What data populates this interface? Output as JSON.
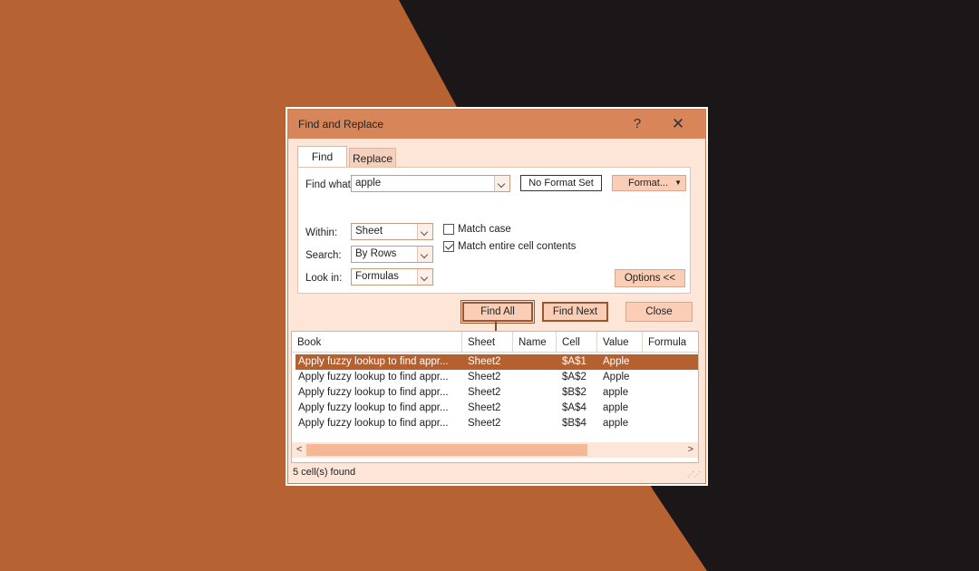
{
  "window": {
    "title": "Find and Replace",
    "help_icon": "?",
    "close_icon": "✕"
  },
  "tabs": [
    {
      "label": "Find",
      "active": true
    },
    {
      "label": "Replace",
      "active": false
    }
  ],
  "find": {
    "find_what_label": "Find what:",
    "find_what_value": "apple",
    "format_status": "No Format Set",
    "format_button": "Format...",
    "within_label": "Within:",
    "within_value": "Sheet",
    "search_label": "Search:",
    "search_value": "By Rows",
    "lookin_label": "Look in:",
    "lookin_value": "Formulas",
    "match_case_label": "Match case",
    "match_case": false,
    "match_entire_label": "Match entire cell contents",
    "match_entire": true,
    "options_button": "Options <<"
  },
  "buttons": {
    "find_all": "Find All",
    "find_next": "Find Next",
    "close": "Close"
  },
  "results": {
    "columns": [
      "Book",
      "Sheet",
      "Name",
      "Cell",
      "Value",
      "Formula"
    ],
    "rows": [
      {
        "book": "Apply fuzzy lookup to find appr...",
        "sheet": "Sheet2",
        "name": "",
        "cell": "$A$1",
        "value": "Apple",
        "formula": ""
      },
      {
        "book": "Apply fuzzy lookup to find appr...",
        "sheet": "Sheet2",
        "name": "",
        "cell": "$A$2",
        "value": "Apple",
        "formula": ""
      },
      {
        "book": "Apply fuzzy lookup to find appr...",
        "sheet": "Sheet2",
        "name": "",
        "cell": "$B$2",
        "value": "apple",
        "formula": ""
      },
      {
        "book": "Apply fuzzy lookup to find appr...",
        "sheet": "Sheet2",
        "name": "",
        "cell": "$A$4",
        "value": "apple",
        "formula": ""
      },
      {
        "book": "Apply fuzzy lookup to find appr...",
        "sheet": "Sheet2",
        "name": "",
        "cell": "$B$4",
        "value": "apple",
        "formula": ""
      }
    ],
    "selected_row": 0
  },
  "status": "5 cell(s) found",
  "colors": {
    "accent": "#b5602f",
    "title_bar": "#d9855a",
    "background_orange": "#b66232",
    "background_dark": "#1b1718"
  }
}
